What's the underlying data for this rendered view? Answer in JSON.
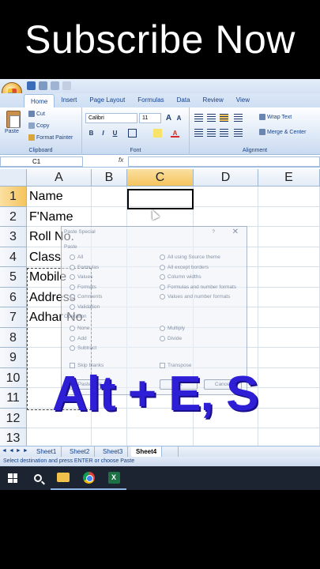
{
  "banner": {
    "text": "Subscribe Now"
  },
  "overlay": {
    "shortcut": "Alt + E, S"
  },
  "tabs": [
    "Home",
    "Insert",
    "Page Layout",
    "Formulas",
    "Data",
    "Review",
    "View"
  ],
  "clipboard": {
    "paste": "Paste",
    "cut": "Cut",
    "copy": "Copy",
    "format_painter": "Format Painter",
    "label": "Clipboard"
  },
  "font": {
    "name": "Calibri",
    "size": "11",
    "grow": "A",
    "shrink": "A",
    "bold": "B",
    "italic": "I",
    "underline": "U",
    "label": "Font"
  },
  "alignment": {
    "wrap": "Wrap Text",
    "merge": "Merge & Center",
    "label": "Alignment"
  },
  "formula_bar": {
    "name_box": "C1",
    "fx": "fx",
    "value": ""
  },
  "columns": [
    "A",
    "B",
    "C",
    "D",
    "E"
  ],
  "rows": [
    "1",
    "2",
    "3",
    "4",
    "5",
    "6",
    "7",
    "8",
    "9",
    "10",
    "11",
    "12",
    "13"
  ],
  "cells_a": [
    "Name",
    "F'Name",
    "Roll No.",
    "Class",
    "Mobile",
    "Address",
    "Adhar No."
  ],
  "dialog": {
    "title": "Paste Special",
    "help": "?",
    "close": "✕",
    "paste_label": "Paste",
    "paste_left": [
      "All",
      "Formulas",
      "Values",
      "Formats",
      "Comments",
      "Validation"
    ],
    "paste_right": [
      "All using Source theme",
      "All except borders",
      "Column widths",
      "Formulas and number formats",
      "Values and number formats"
    ],
    "operation_label": "Operation",
    "op_left": [
      "None",
      "Add",
      "Subtract"
    ],
    "op_right": [
      "Multiply",
      "Divide"
    ],
    "skip_blanks": "Skip blanks",
    "transpose": "Transpose",
    "paste_link": "Paste Link",
    "ok": "OK",
    "cancel": "Cancel"
  },
  "sheets": [
    "Sheet1",
    "Sheet2",
    "Sheet3",
    "Sheet4"
  ],
  "status": "Select destination and press ENTER or choose Paste",
  "colors": {
    "accent_text": "#15428b",
    "overlay": "#2e1fd6",
    "selected_header": "#f5c45e"
  }
}
